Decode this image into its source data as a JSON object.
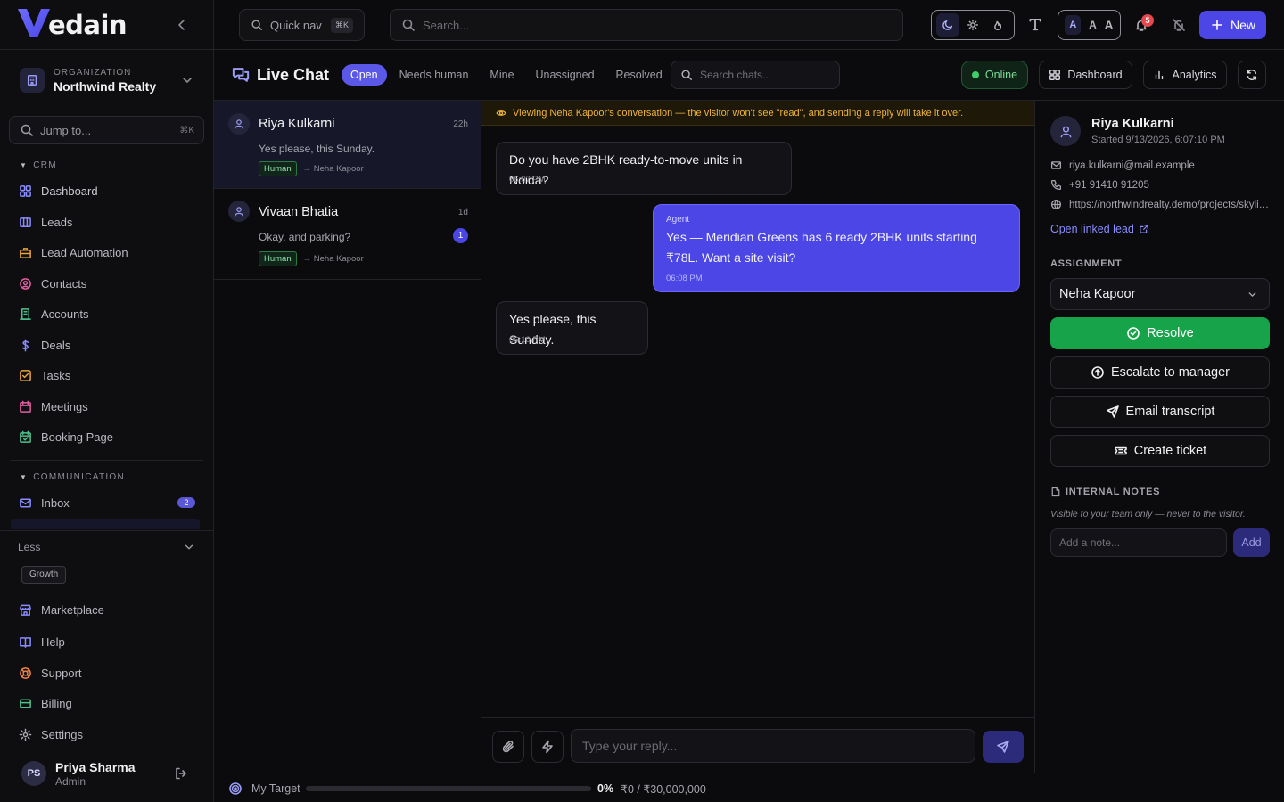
{
  "brand": {
    "logo_text": "edain",
    "accent": "#4b46e5"
  },
  "org": {
    "label": "ORGANIZATION",
    "name": "Northwind Realty"
  },
  "sidebar": {
    "jump_placeholder": "Jump to...",
    "jump_shortcut": "⌘K",
    "crm_header": "CRM",
    "crm_items": [
      {
        "label": "Dashboard",
        "icon": "grid-icon"
      },
      {
        "label": "Leads",
        "icon": "columns-icon"
      },
      {
        "label": "Lead Automation",
        "icon": "briefcase-icon"
      },
      {
        "label": "Contacts",
        "icon": "user-circle-icon"
      },
      {
        "label": "Accounts",
        "icon": "building-icon"
      },
      {
        "label": "Deals",
        "icon": "dollar-icon"
      },
      {
        "label": "Tasks",
        "icon": "checkbox-icon"
      },
      {
        "label": "Meetings",
        "icon": "calendar-icon"
      },
      {
        "label": "Booking Page",
        "icon": "calendar-check-icon"
      }
    ],
    "comm_header": "COMMUNICATION",
    "inbox_label": "Inbox",
    "inbox_count": "2",
    "less_label": "Less",
    "growth_tag": "Growth",
    "bottom_items": [
      {
        "label": "Marketplace",
        "icon": "store-icon"
      },
      {
        "label": "Help",
        "icon": "book-icon"
      },
      {
        "label": "Support",
        "icon": "lifebuoy-icon"
      },
      {
        "label": "Billing",
        "icon": "card-icon"
      },
      {
        "label": "Settings",
        "icon": "gear-icon"
      }
    ],
    "user": {
      "initials": "PS",
      "name": "Priya Sharma",
      "role": "Admin"
    }
  },
  "topbar": {
    "quicknav_label": "Quick nav",
    "quicknav_shortcut": "⌘K",
    "search_placeholder": "Search...",
    "text_size_labels": [
      "A",
      "A",
      "A"
    ],
    "notif_count": "5",
    "new_label": "New"
  },
  "chat": {
    "title": "Live Chat",
    "filters": [
      "Open",
      "Needs human",
      "Mine",
      "Unassigned",
      "Resolved"
    ],
    "active_filter": "Open",
    "search_placeholder": "Search chats...",
    "status": "Online",
    "dashboard_label": "Dashboard",
    "analytics_label": "Analytics",
    "conversations": [
      {
        "name": "Riya Kulkarni",
        "time": "22h",
        "preview": "Yes please, this Sunday.",
        "tag": "Human",
        "assignee": "→ Neha Kapoor",
        "unread": ""
      },
      {
        "name": "Vivaan Bhatia",
        "time": "1d",
        "preview": "Okay, and parking?",
        "tag": "Human",
        "assignee": "→ Neha Kapoor",
        "unread": "1"
      }
    ],
    "banner": "Viewing Neha Kapoor's conversation — the visitor won't see \"read\", and sending a reply will take it over.",
    "messages": [
      {
        "dir": "in",
        "text": "Do you have 2BHK ready-to-move units in Noida?",
        "time": "06:07 PM"
      },
      {
        "dir": "out",
        "sender": "Agent",
        "text": "Yes — Meridian Greens has 6 ready 2BHK units starting ₹78L. Want a site visit?",
        "time": "06:08 PM"
      },
      {
        "dir": "in",
        "text": "Yes please, this Sunday.",
        "time": "06:10 PM"
      }
    ],
    "reply_placeholder": "Type your reply..."
  },
  "target": {
    "label": "My Target",
    "percent_text": "0%",
    "progress": 0,
    "amount": "₹0 / ₹30,000,000"
  },
  "visitor": {
    "name": "Riya Kulkarni",
    "started": "Started 9/13/2026, 6:07:10 PM",
    "email": "riya.kulkarni@mail.example",
    "phone": "+91 91410 91205",
    "url": "https://northwindrealty.demo/projects/skyline-heights",
    "open_lead": "Open linked lead",
    "assignment_header": "ASSIGNMENT",
    "assignee": "Neha Kapoor",
    "resolve": "Resolve",
    "escalate": "Escalate to manager",
    "email_transcript": "Email transcript",
    "create_ticket": "Create ticket",
    "notes_header": "INTERNAL NOTES",
    "notes_hint": "Visible to your team only — never to the visitor.",
    "note_placeholder": "Add a note...",
    "add_label": "Add"
  }
}
